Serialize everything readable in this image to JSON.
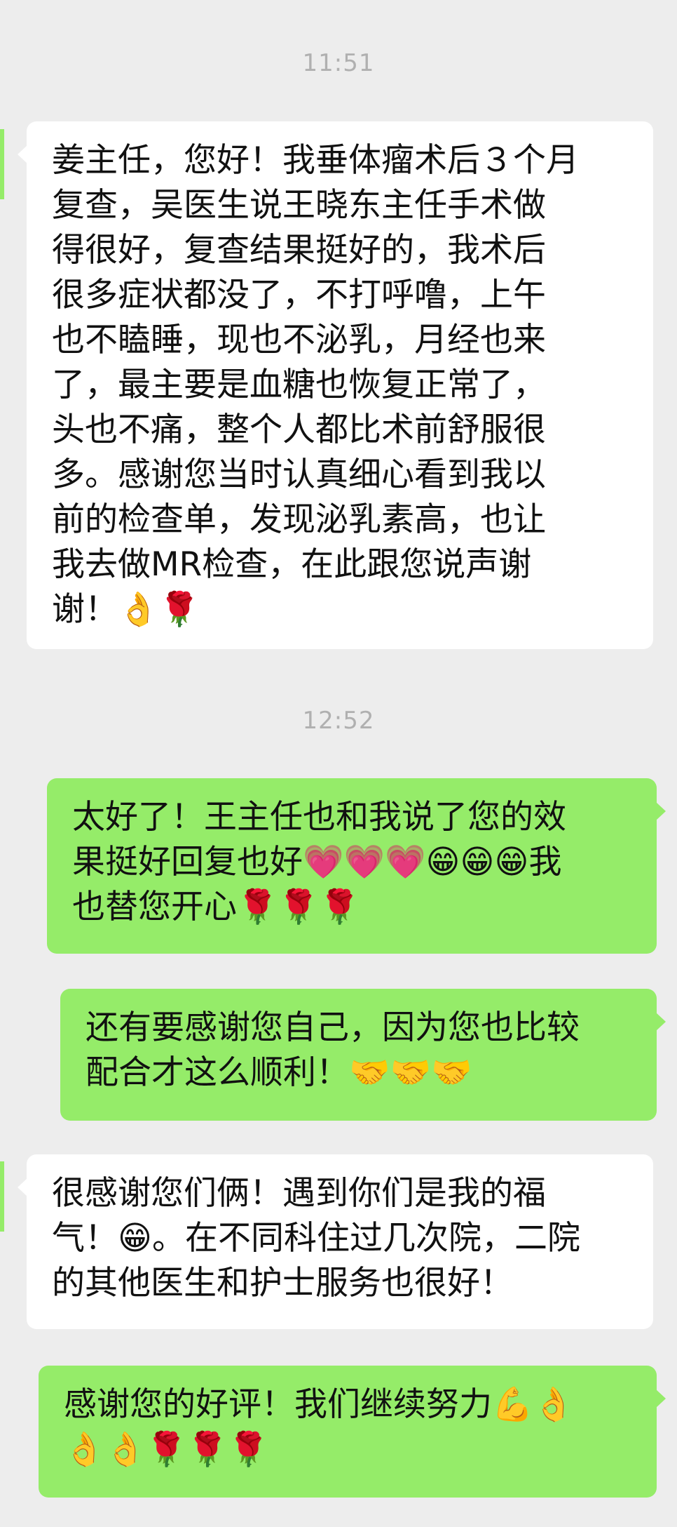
{
  "conversation": {
    "timestamps": [
      "11:51",
      "12:52"
    ],
    "messages": [
      {
        "sender": "incoming",
        "text": "姜主任，您好！我垂体瘤术后３个月\n复查，吴医生说王晓东主任手术做\n得很好，复查结果挺好的，我术后\n很多症状都没了，不打呼噜，上午\n也不瞌睡，现也不泌乳，月经也来\n了，最主要是血糖也恢复正常了，\n头也不痛，整个人都比术前舒服很\n多。感谢您当时认真细心看到我以\n前的检查单，发现泌乳素高，也让\n我去做MR检查，在此跟您说声谢\n谢！👌🌹"
      },
      {
        "sender": "outgoing",
        "text": "太好了！王主任也和我说了您的效\n果挺好回复也好💗💗💗😁😁😁我\n也替您开心🌹🌹🌹"
      },
      {
        "sender": "outgoing",
        "text": "还有要感谢您自己，因为您也比较\n配合才这么顺利！🤝🤝🤝"
      },
      {
        "sender": "incoming",
        "text": "很感谢您们俩！遇到你们是我的福\n气！😁。在不同科住过几次院，二院\n的其他医生和护士服务也很好！"
      },
      {
        "sender": "outgoing",
        "text": "感谢您的好评！我们继续努力💪👌\n👌👌🌹🌹🌹"
      }
    ]
  },
  "colors": {
    "background": "#ededed",
    "incoming_bubble": "#ffffff",
    "outgoing_bubble": "#95ec69",
    "timestamp_text": "#b0b0b0"
  }
}
